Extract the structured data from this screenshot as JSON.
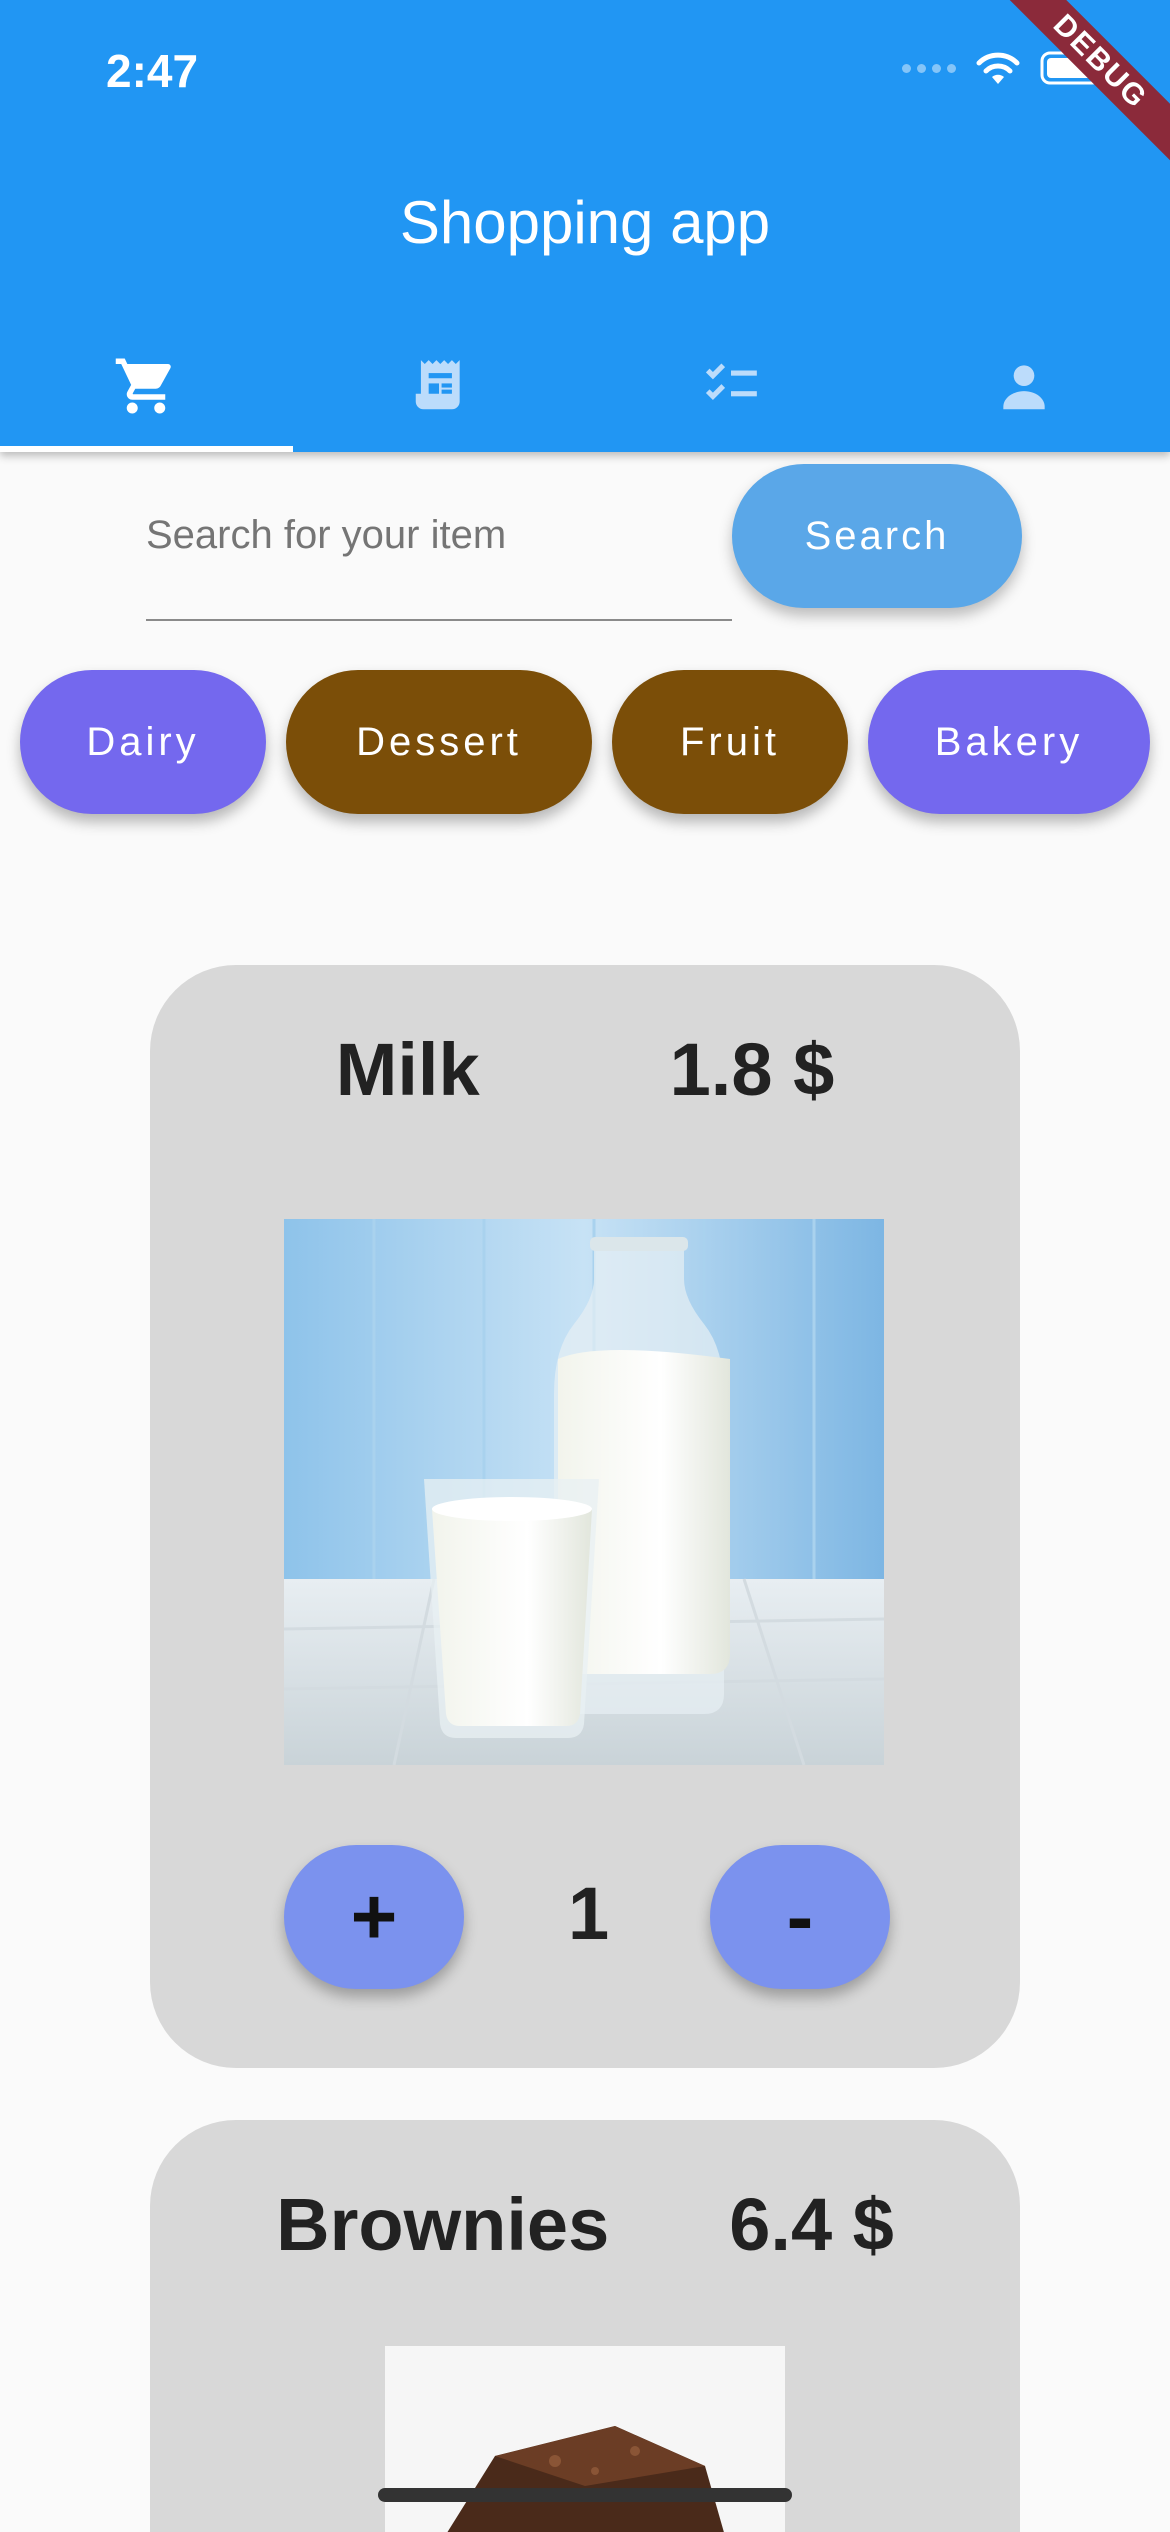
{
  "status_bar": {
    "time": "2:47"
  },
  "debug_banner": "DEBUG",
  "app": {
    "title": "Shopping app"
  },
  "tabs": [
    {
      "icon": "cart-icon",
      "active": true
    },
    {
      "icon": "receipt-icon",
      "active": false
    },
    {
      "icon": "checklist-icon",
      "active": false
    },
    {
      "icon": "person-icon",
      "active": false
    }
  ],
  "search": {
    "placeholder": "Search for your item",
    "value": "",
    "button_label": "Search"
  },
  "categories": [
    {
      "label": "Dairy",
      "color": "#7468ee"
    },
    {
      "label": "Dessert",
      "color": "#7b4e08"
    },
    {
      "label": "Fruit",
      "color": "#7b4e08"
    },
    {
      "label": "Bakery",
      "color": "#7468ee"
    }
  ],
  "products": [
    {
      "name": "Milk",
      "price": "1.8 $",
      "quantity": "1",
      "plus": "+",
      "minus": "-"
    },
    {
      "name": "Brownies",
      "price": "6.4 $"
    }
  ],
  "colors": {
    "app_bar": "#2196f3",
    "card_bg": "#d8d8d8",
    "qty_button": "#7b92ee",
    "search_button": "#5aa7e8"
  }
}
